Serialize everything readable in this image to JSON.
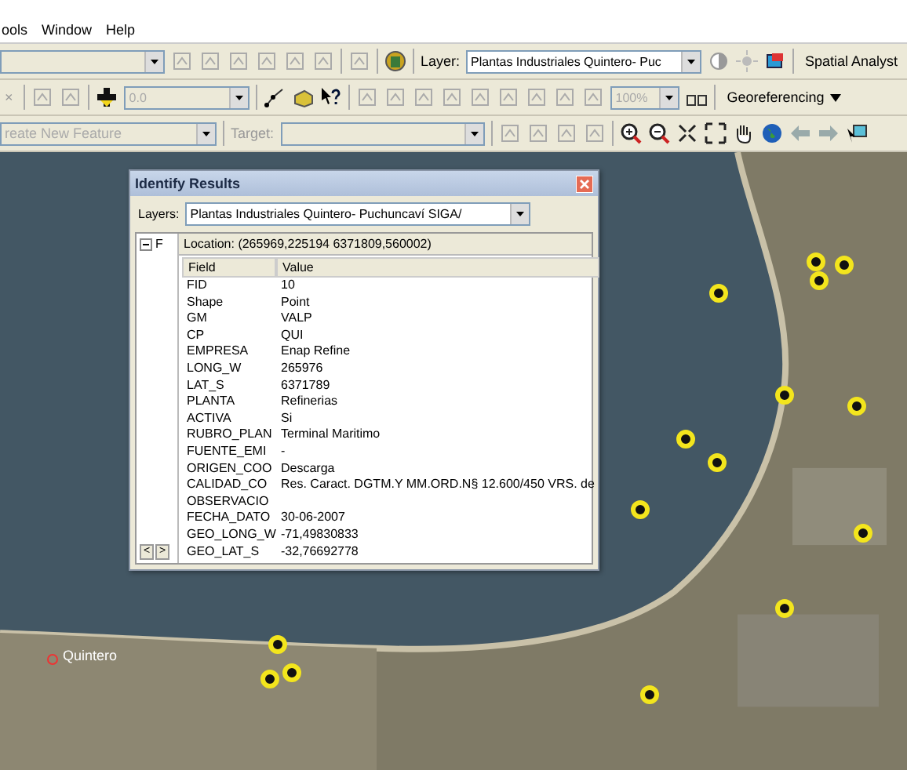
{
  "menu": [
    {
      "label": "ools"
    },
    {
      "label": "Window"
    },
    {
      "label": "Help"
    }
  ],
  "toolbar_1": {
    "layer_label": "Layer:",
    "layer_value": "Plantas Industriales Quintero- Puc",
    "spatial_analyst": "Spatial Analyst"
  },
  "toolbar_2": {
    "close_glyph": "×",
    "scale_value": "0.0",
    "zoom_value": "100%",
    "georeferencing": "Georeferencing"
  },
  "toolbar_3": {
    "task_value": "reate New Feature",
    "target_label": "Target:"
  },
  "map": {
    "place_label": "Quintero"
  },
  "dialog": {
    "title": "Identify Results",
    "layers_label": "Layers:",
    "layers_value": "Plantas Industriales Quintero- Puchuncaví  SIGA/",
    "tree_node": "F",
    "location": "Location: (265969,225194 6371809,560002)",
    "columns": [
      "Field",
      "Value"
    ],
    "rows": [
      [
        "FID",
        "10"
      ],
      [
        "Shape",
        "Point"
      ],
      [
        "GM",
        "VALP"
      ],
      [
        "CP",
        "QUI"
      ],
      [
        "EMPRESA",
        "Enap Refine"
      ],
      [
        "LONG_W",
        "265976"
      ],
      [
        "LAT_S",
        "6371789"
      ],
      [
        "PLANTA",
        "Refinerias"
      ],
      [
        "ACTIVA",
        "Si"
      ],
      [
        "RUBRO_PLAN",
        "Terminal Maritimo"
      ],
      [
        "FUENTE_EMI",
        "-"
      ],
      [
        "ORIGEN_COO",
        "Descarga"
      ],
      [
        "CALIDAD_CO",
        "Res. Caract. DGTM.Y MM.ORD.N§ 12.600/450 VRS. de"
      ],
      [
        "OBSERVACIO",
        ""
      ],
      [
        "FECHA_DATO",
        "30-06-2007"
      ],
      [
        "GEO_LONG_W",
        "-71,49830833"
      ],
      [
        "GEO_LAT_S",
        "-32,76692778"
      ]
    ],
    "scroll_left": "<",
    "scroll_right": ">"
  }
}
